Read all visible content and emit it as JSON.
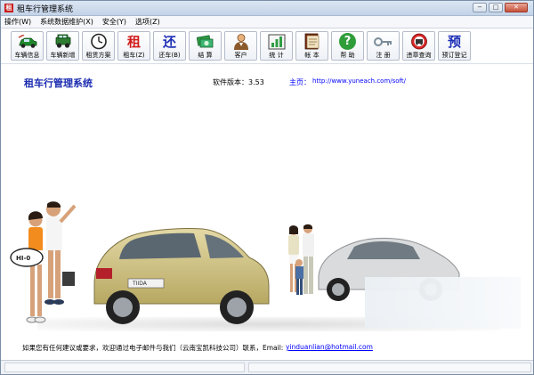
{
  "window": {
    "title": "租车行管理系统",
    "app_icon_glyph": "租",
    "controls": {
      "minimize": "−",
      "maximize": "□",
      "close": "✕"
    }
  },
  "menu": [
    "操作(W)",
    "系统数据维护(X)",
    "安全(Y)",
    "选项(Z)"
  ],
  "toolbar": [
    {
      "label": "车辆信息",
      "icon": "car-icon"
    },
    {
      "label": "车辆新增",
      "icon": "jeep-icon"
    },
    {
      "label": "租赁方案",
      "icon": "clock-icon"
    },
    {
      "label": "租车(Z)",
      "icon": "rent-char-icon",
      "glyph": "租"
    },
    {
      "label": "还车(B)",
      "icon": "return-char-icon",
      "glyph": "还"
    },
    {
      "label": "结 算",
      "icon": "money-icon"
    },
    {
      "label": "客户",
      "icon": "customer-icon"
    },
    {
      "label": "统 计",
      "icon": "chart-icon"
    },
    {
      "label": "帐 本",
      "icon": "ledger-icon"
    },
    {
      "label": "帮 助",
      "icon": "help-icon",
      "glyph": "?"
    },
    {
      "label": "注 册",
      "icon": "key-icon"
    },
    {
      "label": "违章查询",
      "icon": "no-entry-icon"
    },
    {
      "label": "预订登记",
      "icon": "reserve-char-icon",
      "glyph": "预"
    }
  ],
  "header": {
    "app_name": "租车行管理系统",
    "version_text": "软件版本：3.53",
    "homepage_label": "主页：",
    "homepage_url": "http://www.yuneach.com/soft/"
  },
  "footer": {
    "contact_text": "如果您有任何建议或要求，欢迎通过电子邮件与我们（云南宝凯科技公司）联系，Email:",
    "email": "yinduanlian@hotmail.com"
  },
  "scene_labels": {
    "ball_text": "HI-0",
    "plate_text": "TIIDA"
  },
  "colors": {
    "accent": "#1a2bb0",
    "link": "#0000ff",
    "car_gold": "#cfc183",
    "car_silver": "#d7d9da"
  }
}
